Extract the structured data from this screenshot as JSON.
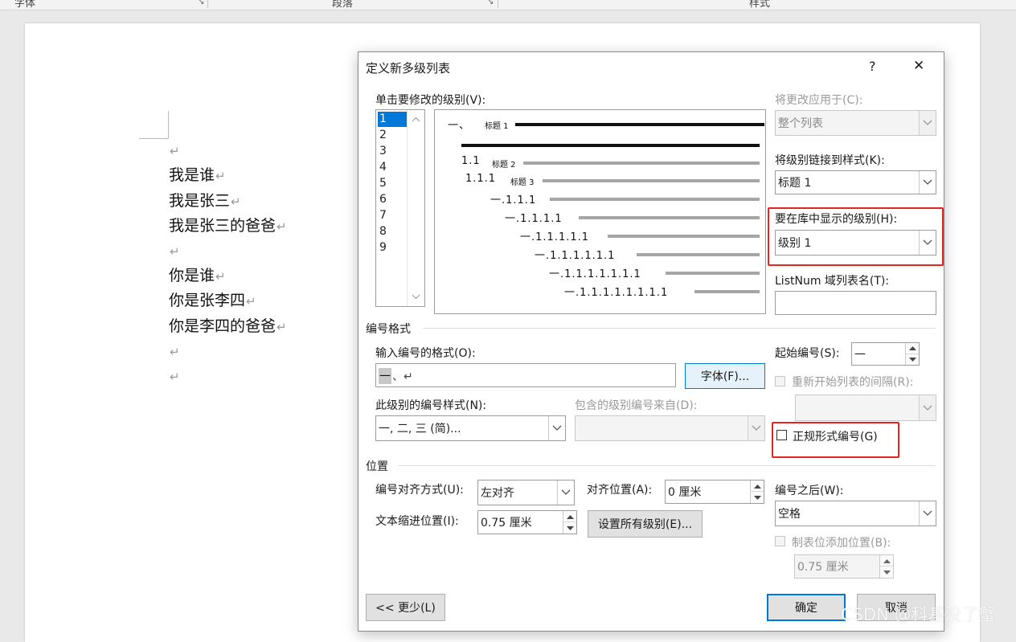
{
  "ribbon": {
    "groups": [
      "字体",
      "段落",
      "样式"
    ]
  },
  "document": {
    "lines": [
      "",
      "我是谁",
      "我是张三",
      "我是张三的爸爸",
      "",
      "你是谁",
      "你是张李四",
      "你是李四的爸爸",
      "",
      ""
    ],
    "paragraph_mark": "↵"
  },
  "dialog": {
    "title": "定义新多级列表",
    "help": "?",
    "close": "✕",
    "levels_label": "单击要修改的级别(V):",
    "levels": [
      "1",
      "2",
      "3",
      "4",
      "5",
      "6",
      "7",
      "8",
      "9"
    ],
    "selected_level": "1",
    "preview": [
      {
        "num": "一、",
        "heading": "标题 1"
      },
      {
        "num": "",
        "heading": ""
      },
      {
        "num": "1.1",
        "heading": "标题 2"
      },
      {
        "num": "1.1.1",
        "heading": "标题 3"
      },
      {
        "num": "一.1.1.1",
        "heading": ""
      },
      {
        "num": "一.1.1.1.1",
        "heading": ""
      },
      {
        "num": "一.1.1.1.1.1",
        "heading": ""
      },
      {
        "num": "一.1.1.1.1.1.1",
        "heading": ""
      },
      {
        "num": "一.1.1.1.1.1.1.1",
        "heading": ""
      },
      {
        "num": "一.1.1.1.1.1.1.1.1",
        "heading": ""
      }
    ],
    "apply_to": {
      "label": "将更改应用于(C):",
      "value": "整个列表"
    },
    "link_style": {
      "label": "将级别链接到样式(K):",
      "value": "标题 1"
    },
    "gallery_level": {
      "label": "要在库中显示的级别(H):",
      "value": "级别 1"
    },
    "listnum": {
      "label": "ListNum 域列表名(T):",
      "value": ""
    },
    "number_format_section": "编号格式",
    "format_input": {
      "label": "输入编号的格式(O):",
      "value": "一、↵"
    },
    "font_button": "字体(F)...",
    "start_at": {
      "label": "起始编号(S):",
      "value": "一"
    },
    "restart": {
      "label": "重新开始列表的间隔(R):",
      "value": ""
    },
    "number_style": {
      "label": "此级别的编号样式(N):",
      "value": "一, 二, 三 (简)..."
    },
    "include_from": {
      "label": "包含的级别编号来自(D):",
      "value": ""
    },
    "legal": {
      "label": "正规形式编号(G)",
      "checked": false
    },
    "position_section": "位置",
    "alignment": {
      "label": "编号对齐方式(U):",
      "value": "左对齐"
    },
    "aligned_at": {
      "label": "对齐位置(A):",
      "value": "0 厘米"
    },
    "indent_at": {
      "label": "文本缩进位置(I):",
      "value": "0.75 厘米"
    },
    "set_all_button": "设置所有级别(E)...",
    "follow_with": {
      "label": "编号之后(W):",
      "value": "空格"
    },
    "tab_stop": {
      "label": "制表位添加位置(B):",
      "value": "0.75 厘米"
    },
    "less_button": "<< 更少(L)",
    "ok_button": "确定",
    "cancel_button": "取消"
  },
  "watermark": "CSDN @科基没了蟹",
  "colors": {
    "highlight": "#e8251c",
    "selection": "#0078d7"
  }
}
